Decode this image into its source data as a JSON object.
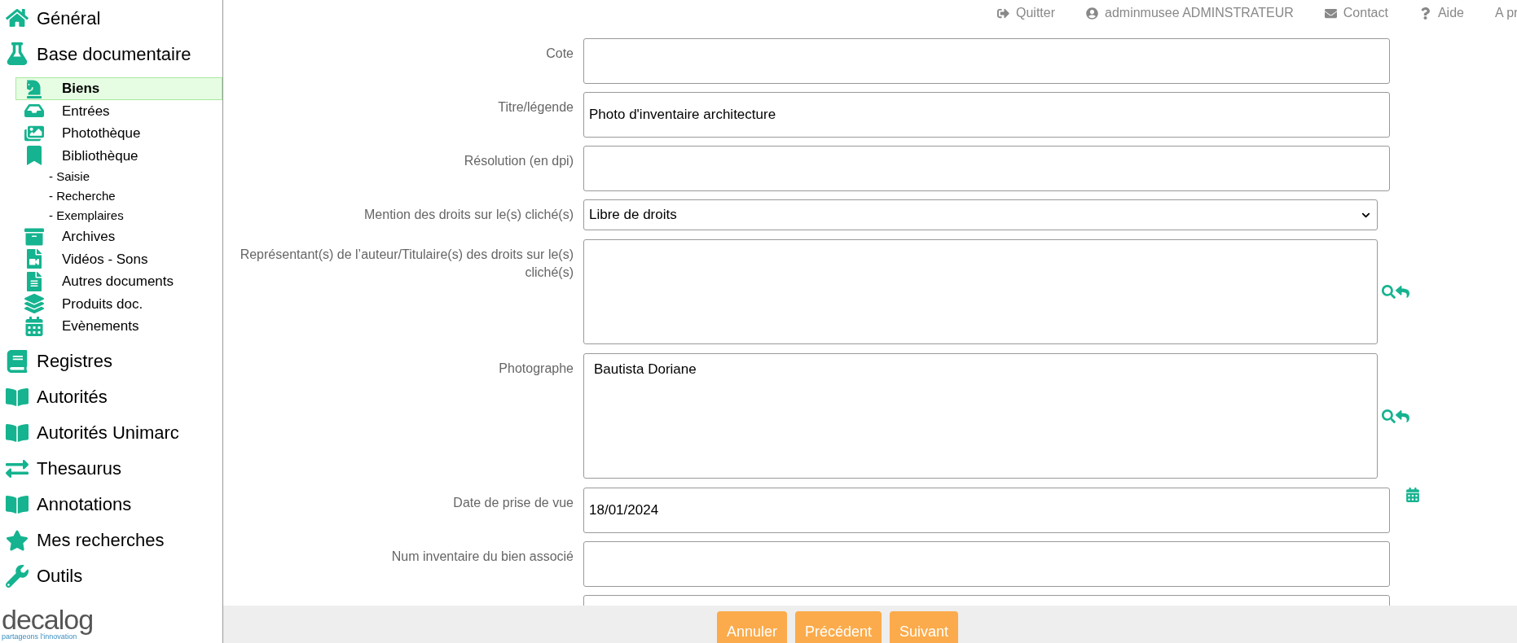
{
  "sidebar": {
    "items": [
      {
        "label": "Général",
        "selected": false
      },
      {
        "label": "Base documentaire",
        "selected": false,
        "children": [
          {
            "label": "Biens",
            "selected": true
          },
          {
            "label": "Entrées",
            "selected": false
          },
          {
            "label": "Photothèque",
            "selected": false
          },
          {
            "label": "Bibliothèque",
            "selected": false,
            "children": [
              {
                "label": "- Saisie",
                "selected": false
              },
              {
                "label": "- Recherche",
                "selected": false
              },
              {
                "label": "- Exemplaires",
                "selected": false
              }
            ]
          },
          {
            "label": "Archives",
            "selected": false
          },
          {
            "label": "Vidéos - Sons",
            "selected": false
          },
          {
            "label": "Autres documents",
            "selected": false
          },
          {
            "label": "Produits doc.",
            "selected": false
          },
          {
            "label": "Evènements",
            "selected": false
          }
        ]
      },
      {
        "label": "Registres",
        "selected": false
      },
      {
        "label": "Autorités",
        "selected": false
      },
      {
        "label": "Autorités Unimarc",
        "selected": false
      },
      {
        "label": "Thesaurus",
        "selected": false
      },
      {
        "label": "Annotations",
        "selected": false
      },
      {
        "label": "Mes recherches",
        "selected": false
      },
      {
        "label": "Outils",
        "selected": false
      }
    ],
    "logo": {
      "name": "decalog",
      "tagline": "partageons l'innovation"
    }
  },
  "top_bar": {
    "links": [
      {
        "label": "Quitter"
      },
      {
        "label": "adminmusee ADMINSTRATEUR"
      },
      {
        "label": "Contact"
      },
      {
        "label": "Aide"
      },
      {
        "label": "A pr"
      }
    ]
  },
  "form": {
    "fields": [
      {
        "kind": "text",
        "label": "Cote"
      },
      {
        "kind": "text",
        "label": "Titre/légende",
        "value": "Photo d'inventaire architecture"
      },
      {
        "kind": "text",
        "label": "Résolution (en dpi)"
      },
      {
        "kind": "select",
        "label": "Mention des droits sur le(s) cliché(s)",
        "value": "Libre de droits"
      },
      {
        "kind": "lookup",
        "label": "Représentant(s) de l’auteur/Titulaire(s) des droits sur le(s) cliché(s)"
      },
      {
        "kind": "lookup",
        "label": "Photographe",
        "value": "Bautista Doriane"
      },
      {
        "kind": "date",
        "label": "Date de prise de vue",
        "value": "18/01/2024"
      },
      {
        "kind": "text",
        "label": "Num inventaire du bien associé"
      },
      {
        "kind": "text"
      }
    ]
  },
  "footer": {
    "buttons": [
      "Annuler",
      "Précédent",
      "Suivant"
    ]
  }
}
